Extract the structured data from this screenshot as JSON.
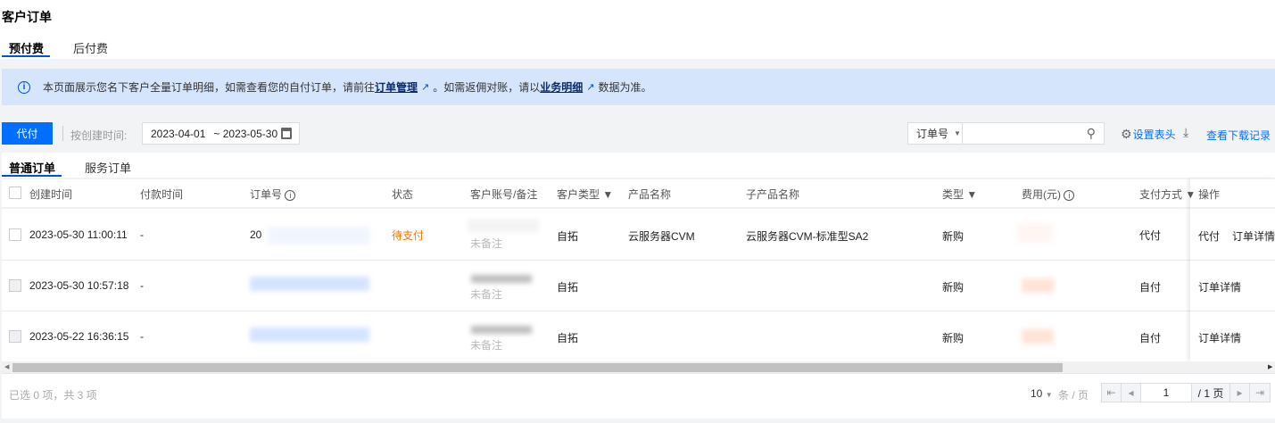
{
  "page_title": "客户订单",
  "billing_tabs": [
    {
      "label": "预付费",
      "active": true
    },
    {
      "label": "后付费",
      "active": false
    }
  ],
  "banner": {
    "text_before": "本页面展示您名下客户全量订单明细，如需查看您的自付订单，请前往",
    "link1": "订单管理",
    "text_middle": "。如需返佣对账，请以",
    "link2": "业务明细",
    "text_after": "数据为准。"
  },
  "toolbar": {
    "pay_button": "代付",
    "time_label": "按创建时间:",
    "date_start": "2023-04-01",
    "date_end": "~ 2023-05-30",
    "search_field": "订单号",
    "search_value": "",
    "set_header": "设置表头",
    "download_records": "查看下载记录"
  },
  "order_tabs": [
    {
      "label": "普通订单",
      "active": true
    },
    {
      "label": "服务订单",
      "active": false
    }
  ],
  "columns": [
    "创建时间",
    "付款时间",
    "订单号",
    "状态",
    "客户账号/备注",
    "客户类型",
    "产品名称",
    "子产品名称",
    "类型",
    "费用(元)",
    "支付方式",
    "操作"
  ],
  "rows": [
    {
      "created": "2023-05-30 11:00:11",
      "paid": "-",
      "order_no": "20",
      "status": "待支付",
      "remark": "未备注",
      "customer_type": "自拓",
      "product": "云服务器CVM",
      "sub_product": "云服务器CVM-标准型SA2",
      "type": "新购",
      "pay_method": "代付",
      "actions": [
        "代付",
        "订单详情"
      ]
    },
    {
      "created": "2023-05-30 10:57:18",
      "paid": "-",
      "order_no": "",
      "status": "",
      "remark": "未备注",
      "customer_type": "自拓",
      "product": "",
      "sub_product": "",
      "type": "新购",
      "pay_method": "自付",
      "actions": [
        "订单详情"
      ]
    },
    {
      "created": "2023-05-22 16:36:15",
      "paid": "-",
      "order_no": "",
      "status": "",
      "remark": "未备注",
      "customer_type": "自拓",
      "product": "",
      "sub_product": "",
      "type": "新购",
      "pay_method": "自付",
      "actions": [
        "订单详情"
      ]
    }
  ],
  "footer": {
    "selection": "已选 0 项，共 3 项",
    "page_size": "10",
    "per_page": "条 / 页",
    "page": "1",
    "total_pages": "/ 1 页"
  },
  "colors": {
    "primary": "#006eff",
    "pending": "#ff7200",
    "banner_bg": "#d5e5fc"
  }
}
